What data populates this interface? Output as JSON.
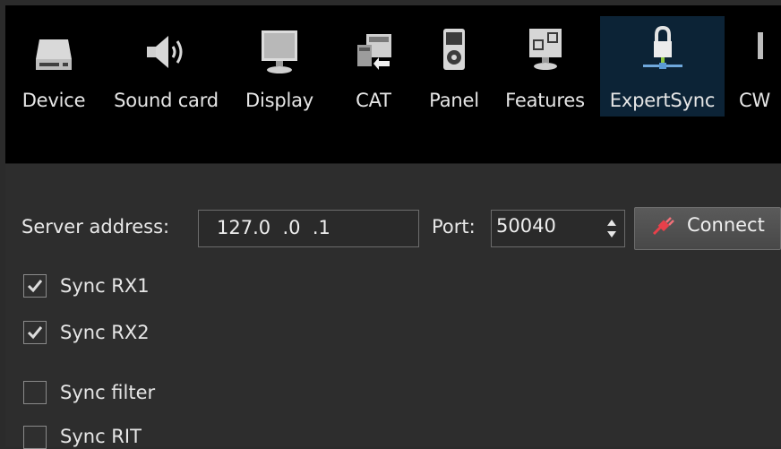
{
  "tabs": [
    {
      "label": "Device",
      "icon": "drive-icon"
    },
    {
      "label": "Sound card",
      "icon": "speaker-icon"
    },
    {
      "label": "Display",
      "icon": "monitor-icon"
    },
    {
      "label": "CAT",
      "icon": "cat-icon"
    },
    {
      "label": "Panel",
      "icon": "panel-icon"
    },
    {
      "label": "Features",
      "icon": "features-icon"
    },
    {
      "label": "ExpertSync",
      "icon": "lock-network-icon",
      "active": true
    },
    {
      "label": "CW",
      "icon": "cw-icon"
    }
  ],
  "server": {
    "label": "Server address:",
    "value": "127.0  .0  .1",
    "port_label": "Port:",
    "port_value": "50040",
    "connect_label": "Connect"
  },
  "options": [
    {
      "label": "Sync RX1",
      "checked": true
    },
    {
      "label": "Sync RX2",
      "checked": true
    },
    {
      "label": "Sync filter",
      "checked": false
    },
    {
      "label": "Sync RIT",
      "checked": false
    }
  ],
  "colors": {
    "toolbar_bg": "#000000",
    "active_tab": "#0c2336",
    "content_bg": "#2d2d2d",
    "accent": "#e8404a"
  }
}
